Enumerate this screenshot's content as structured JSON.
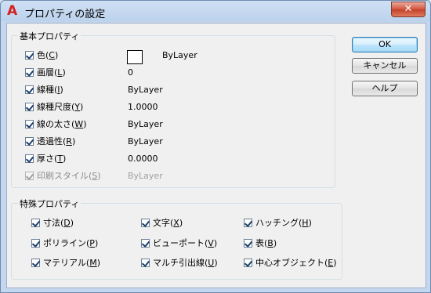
{
  "window": {
    "title": "プロパティの設定",
    "close": "✕",
    "app_icon": "autocad-icon"
  },
  "basic": {
    "title": "基本プロパティ",
    "items": [
      {
        "label": "色",
        "key": "C",
        "value": "ByLayer",
        "checked": true,
        "swatch": "#ffffff"
      },
      {
        "label": "画層",
        "key": "L",
        "value": "0",
        "checked": true
      },
      {
        "label": "線種",
        "key": "I",
        "value": "ByLayer",
        "checked": true
      },
      {
        "label": "線種尺度",
        "key": "Y",
        "value": "1.0000",
        "checked": true
      },
      {
        "label": "線の太さ",
        "key": "W",
        "value": "ByLayer",
        "checked": true
      },
      {
        "label": "透過性",
        "key": "R",
        "value": "ByLayer",
        "checked": true
      },
      {
        "label": "厚さ",
        "key": "T",
        "value": "0.0000",
        "checked": true
      },
      {
        "label": "印刷スタイル",
        "key": "S",
        "value": "ByLayer",
        "checked": true,
        "disabled": true
      }
    ]
  },
  "special": {
    "title": "特殊プロパティ",
    "items": [
      {
        "label": "寸法",
        "key": "D"
      },
      {
        "label": "文字",
        "key": "X"
      },
      {
        "label": "ハッチング",
        "key": "H"
      },
      {
        "label": "ポリライン",
        "key": "P"
      },
      {
        "label": "ビューポート",
        "key": "V"
      },
      {
        "label": "表",
        "key": "B"
      },
      {
        "label": "マテリアル",
        "key": "M"
      },
      {
        "label": "マルチ引出線",
        "key": "U"
      },
      {
        "label": "中心オブジェクト",
        "key": "E"
      }
    ]
  },
  "buttons": {
    "ok": "OK",
    "cancel": "キャンセル",
    "help": "ヘルプ"
  }
}
